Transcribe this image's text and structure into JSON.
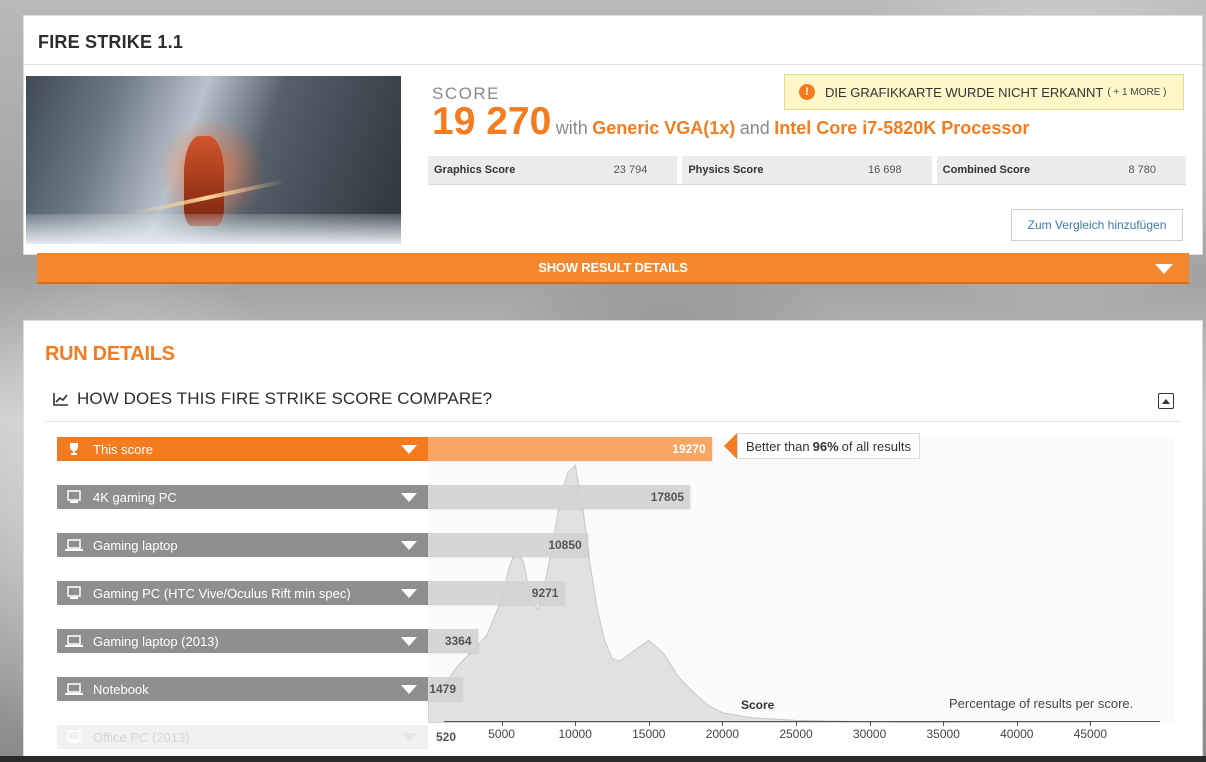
{
  "result": {
    "title": "FIRE STRIKE 1.1",
    "score_label": "SCORE",
    "score_value": "19 270",
    "with_text": "with",
    "gpu": "Generic VGA(1x)",
    "and_text": "and",
    "cpu": "Intel Core i7-5820K Processor",
    "warning": "DIE GRAFIKKARTE WURDE NICHT ERKANNT",
    "warning_more": "( + 1 MORE )",
    "subscores": [
      {
        "label": "Graphics Score",
        "value": "23 794"
      },
      {
        "label": "Physics Score",
        "value": "16 698"
      },
      {
        "label": "Combined Score",
        "value": "8 780"
      }
    ],
    "compare_button": "Zum Vergleich hinzufügen",
    "show_details": "SHOW RESULT DETAILS"
  },
  "run_details": {
    "title": "RUN DETAILS",
    "compare_heading": "HOW DOES THIS FIRE STRIKE SCORE COMPARE?",
    "better_prefix": "Better than",
    "better_percent": "96%",
    "better_suffix": "of all results",
    "x_axis_title": "Score",
    "x_axis_note": "Percentage of results per score."
  },
  "colors": {
    "accent": "#f37c20",
    "bar_this": "#f9a664",
    "label_gray": "#8f8f8f"
  },
  "chart_data": {
    "type": "bar",
    "orientation": "horizontal",
    "categories": [
      "This score",
      "4K gaming PC",
      "Gaming laptop",
      "Gaming PC (HTC Vive/Oculus Rift min spec)",
      "Gaming laptop (2013)",
      "Notebook",
      "Office PC (2013)"
    ],
    "icons": [
      "trophy-icon",
      "desktop-icon",
      "laptop-icon",
      "desktop-icon",
      "laptop-icon",
      "laptop-icon",
      "desktop-icon"
    ],
    "values": [
      19270,
      17805,
      10850,
      9271,
      3364,
      1479,
      520
    ],
    "value_labels": [
      "19270",
      "17805",
      "10850",
      "9271",
      "3364",
      "1479",
      "520"
    ],
    "xlim": [
      0,
      48500
    ],
    "x_ticks": [
      5000,
      10000,
      15000,
      20000,
      25000,
      30000,
      35000,
      40000,
      45000
    ],
    "x_tick_labels": [
      "5000",
      "10000",
      "15000",
      "20000",
      "25000",
      "30000",
      "35000",
      "40000",
      "45000"
    ],
    "xlabel": "Score",
    "distribution": {
      "x": [
        0,
        1000,
        2000,
        3000,
        4000,
        5000,
        5500,
        6000,
        6500,
        7000,
        7500,
        8000,
        8500,
        9000,
        9500,
        10000,
        10500,
        11000,
        11500,
        12000,
        12500,
        13000,
        14000,
        15000,
        16000,
        17000,
        18000,
        19000,
        20000,
        22000,
        25000,
        30000,
        35000,
        40000,
        45000
      ],
      "y": [
        8,
        14,
        22,
        28,
        34,
        48,
        60,
        68,
        62,
        48,
        44,
        56,
        70,
        88,
        97,
        100,
        84,
        62,
        44,
        32,
        25,
        24,
        28,
        32,
        27,
        18,
        12,
        7,
        4,
        2,
        1,
        0.5,
        0.2,
        0.1,
        0.05
      ]
    }
  }
}
